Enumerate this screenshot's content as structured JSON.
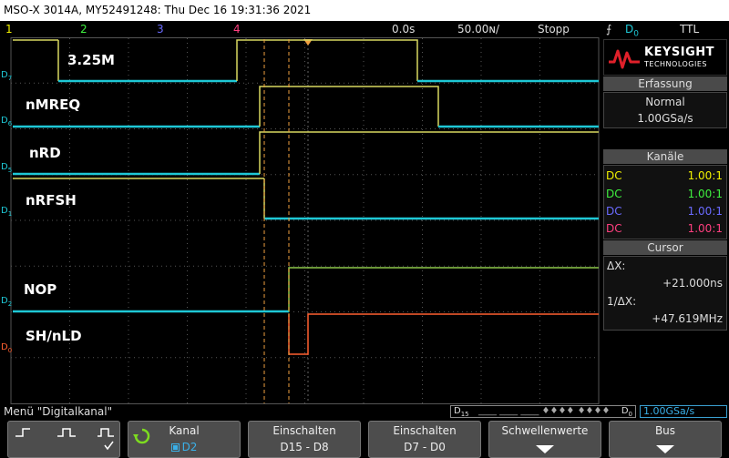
{
  "title": "MSO-X 3014A, MY52491248: Thu Dec 16 19:31:36 2021",
  "status": {
    "ch1": "1",
    "ch2": "2",
    "ch3": "3",
    "ch4": "4",
    "time_offset": "0.0s",
    "timebase": "50.00ɴ/",
    "run_state": "Stopp",
    "trigger_source": "D",
    "trigger_source_sub": "0",
    "trigger_type": "TTL"
  },
  "brand": {
    "name": "KEYSIGHT",
    "sub": "TECHNOLOGIES"
  },
  "acquisition": {
    "header": "Erfassung",
    "mode": "Normal",
    "rate": "1.00GSa/s"
  },
  "channels": {
    "header": "Kanäle",
    "rows": [
      {
        "coupling": "DC",
        "ratio": "1.00:1",
        "color": "#f0f000"
      },
      {
        "coupling": "DC",
        "ratio": "1.00:1",
        "color": "#3ff03f"
      },
      {
        "coupling": "DC",
        "ratio": "1.00:1",
        "color": "#6a6aff"
      },
      {
        "coupling": "DC",
        "ratio": "1.00:1",
        "color": "#ff3f7f"
      }
    ]
  },
  "cursor": {
    "header": "Cursor",
    "dx_label": "ΔX:",
    "dx_value": "+21.000ns",
    "inv_label": "1/ΔX:",
    "inv_value": "+47.619MHz"
  },
  "signals": [
    {
      "label": "3.25M",
      "digital": "D",
      "sub": "7"
    },
    {
      "label": "nMREQ",
      "digital": "D",
      "sub": "6"
    },
    {
      "label": "nRD",
      "digital": "D",
      "sub": "5"
    },
    {
      "label": "nRFSH",
      "digital": "D",
      "sub": "1"
    },
    {
      "label": "NOP",
      "digital": "D",
      "sub": "2"
    },
    {
      "label": "SH/nLD",
      "digital": "D",
      "sub": "0"
    }
  ],
  "menu_title": "Menü \"Digitalkanal\"",
  "digital_bar": {
    "left": "D",
    "left_sub": "15",
    "right": "D",
    "right_sub": "0",
    "rate": "1.00GSa/s"
  },
  "softkeys": {
    "kanal_label": "Kanal",
    "kanal_value": "D2",
    "on_hi_label": "Einschalten",
    "on_hi_value": "D15 - D8",
    "on_lo_label": "Einschalten",
    "on_lo_value": "D7 - D0",
    "threshold_label": "Schwellenwerte",
    "bus_label": "Bus"
  },
  "colors": {
    "digital": "#1ec8d6",
    "cursor": "#f0a040",
    "nop_line": "#8ec84a",
    "shld": "#ff6030"
  }
}
